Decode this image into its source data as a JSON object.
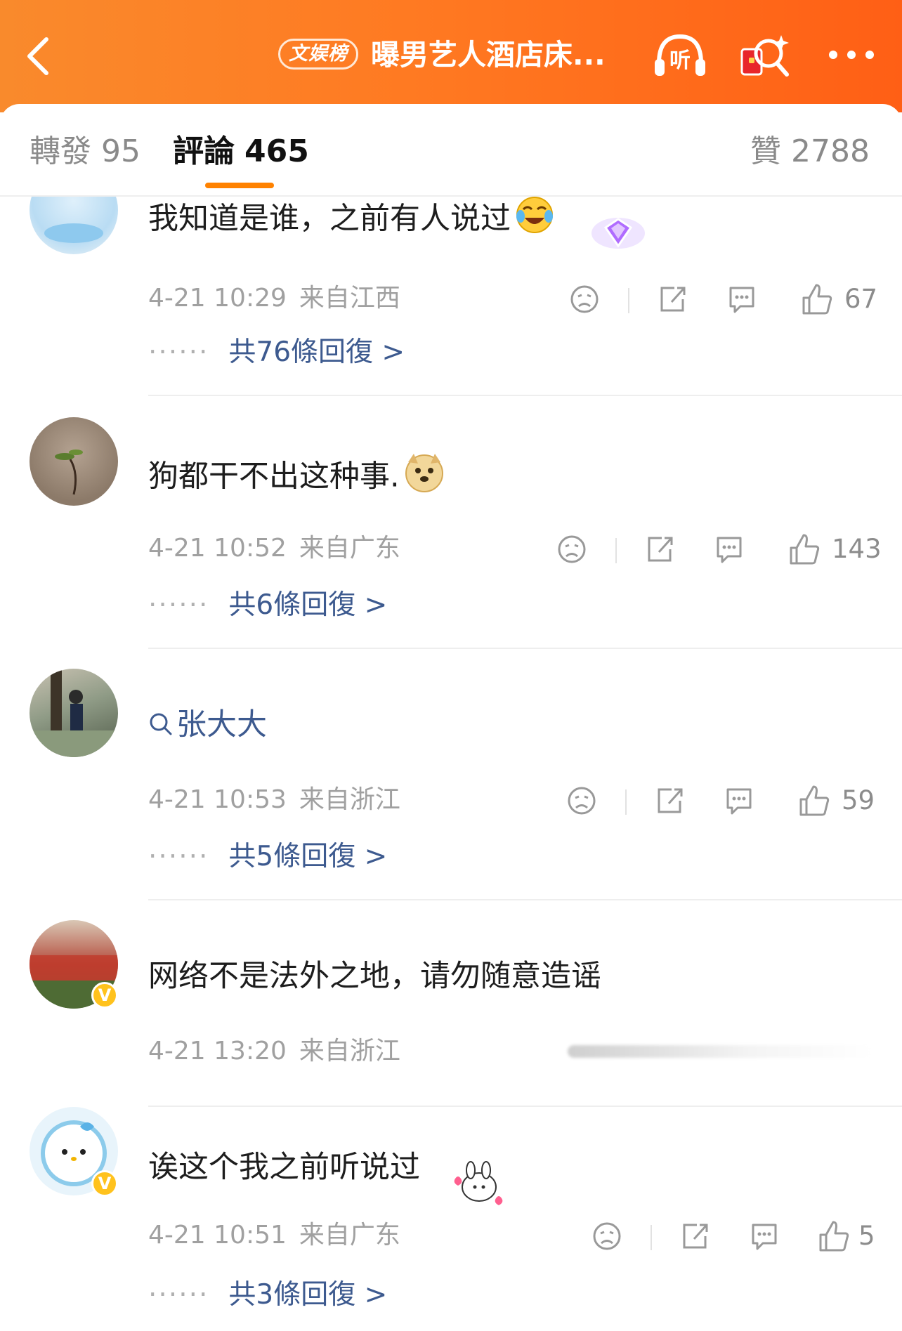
{
  "header": {
    "rank_badge": "文娱榜",
    "title": "曝男艺人酒店床...",
    "listen_label": "听",
    "colors": {
      "start": "#f98a2c",
      "end": "#ff5f15"
    }
  },
  "tabs": {
    "repost": {
      "label": "轉發",
      "count": "95"
    },
    "comment": {
      "label": "評論",
      "count": "465"
    },
    "like": {
      "label": "贊",
      "count": "2788"
    }
  },
  "comments": [
    {
      "text": "我知道是谁，之前有人说过",
      "time": "4-21 10:29",
      "location": "来自江西",
      "likes": "67",
      "replies": "共76條回復 >"
    },
    {
      "text": "狗都干不出这种事.",
      "time": "4-21 10:52",
      "location": "来自广东",
      "likes": "143",
      "replies": "共6條回復 >"
    },
    {
      "text": "张大大",
      "time": "4-21 10:53",
      "location": "来自浙江",
      "likes": "59",
      "replies": "共5條回復 >"
    },
    {
      "text": "网络不是法外之地，请勿随意造谣",
      "time": "4-21 13:20",
      "location": "来自浙江"
    },
    {
      "text": "诶这个我之前听说过",
      "time": "4-21 10:51",
      "location": "来自广东",
      "likes": "5",
      "replies": "共3條回復 >"
    }
  ],
  "icons": [
    "back-arrow-icon",
    "listen-icon",
    "red-packet-icon",
    "more-icon",
    "dislike-face-icon",
    "share-icon",
    "comment-bubble-icon",
    "thumbs-up-icon",
    "search-icon",
    "verified-badge-icon"
  ],
  "accent": "#ff8200"
}
